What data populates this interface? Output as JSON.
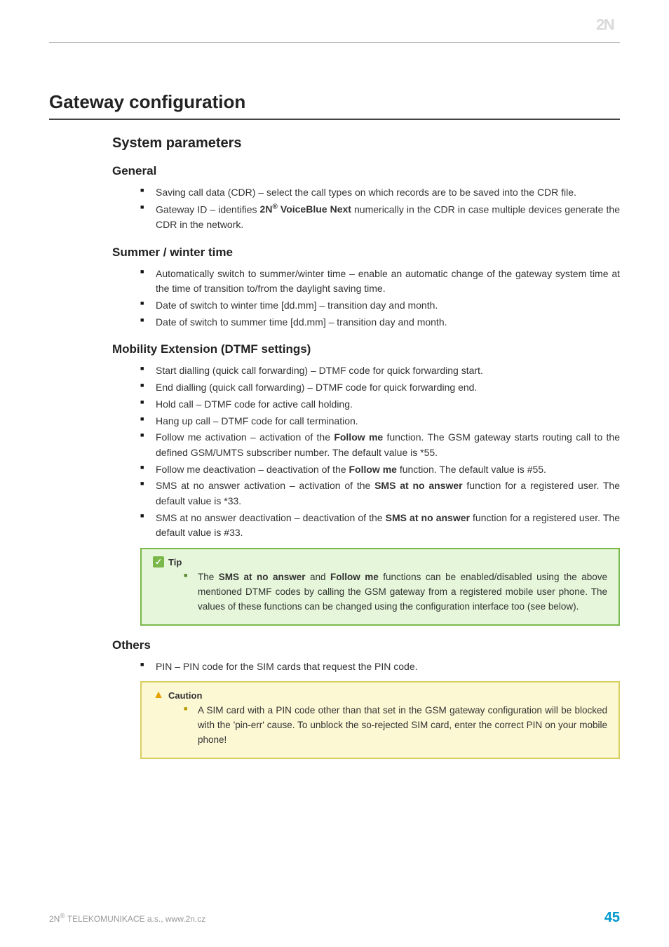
{
  "header": {
    "brand": "2N"
  },
  "title": "Gateway configuration",
  "sections": [
    {
      "h2": "System parameters",
      "subs": [
        {
          "h3": "General",
          "items": [
            "Saving call data (CDR) – select the call types on which records are to be saved into the CDR file.",
            "Gateway ID – identifies <b>2N<span class=\"sup\">®</span> VoiceBlue Next</b> numerically in the CDR in case multiple devices generate the CDR in the network."
          ]
        },
        {
          "h3": "Summer / winter time",
          "items": [
            "Automatically switch to summer/winter time – enable an automatic change of the gateway system time at the time of transition to/from the daylight saving time.",
            "Date of switch to winter time [dd.mm] – transition day and month.",
            "Date of switch to summer time [dd.mm] – transition day and month."
          ]
        },
        {
          "h3": "Mobility Extension (DTMF settings)",
          "items": [
            "Start dialling (quick call forwarding) – DTMF code for quick forwarding start.",
            "End dialling (quick call forwarding) – DTMF code for quick forwarding end.",
            "Hold call – DTMF code for active call holding.",
            "Hang up call – DTMF code for call termination.",
            "Follow me activation – activation of the <b>Follow me</b> function. The GSM gateway starts routing call to the defined GSM/UMTS subscriber number. The default value is *55.",
            "Follow me deactivation – deactivation of the <b>Follow me</b> function. The default value is #55.",
            "SMS at no answer activation – activation of the <b>SMS at no answer</b> function for a registered user. The default value is *33.",
            "SMS at no answer deactivation – deactivation of the <b>SMS at no answer</b> function for a registered user. The default value is #33."
          ],
          "callout": {
            "type": "tip",
            "title": "Tip",
            "items": [
              "The <b>SMS at no answer</b> and <b>Follow me</b> functions can be enabled/disabled using the above mentioned DTMF codes by calling the GSM gateway from a registered mobile user phone. The values of these functions can be changed using the configuration interface too (see below)."
            ]
          }
        },
        {
          "h3": "Others",
          "items": [
            "PIN – PIN code for the SIM cards that request the PIN code."
          ],
          "callout": {
            "type": "caution",
            "title": "Caution",
            "items": [
              "A SIM card with a PIN code other than that set in the GSM gateway configuration will be blocked with the 'pin-err' cause. To unblock the so-rejected SIM card, enter the correct PIN on your mobile phone!"
            ]
          }
        }
      ]
    }
  ],
  "footer": {
    "left": "2N® TELEKOMUNIKACE a.s., www.2n.cz",
    "page": "45"
  }
}
